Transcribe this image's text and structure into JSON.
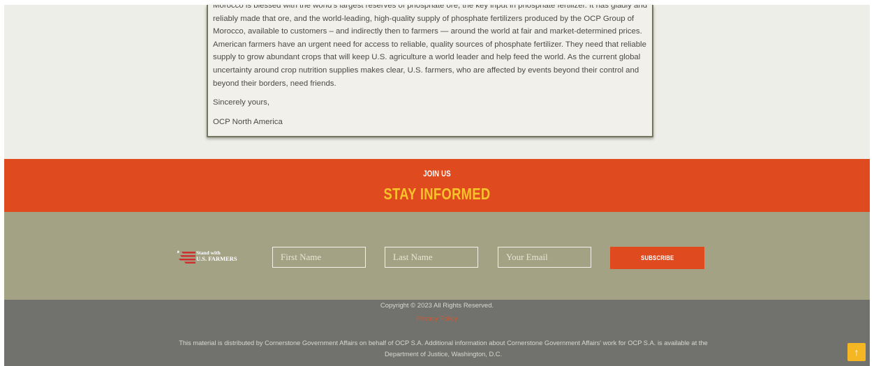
{
  "letter": {
    "paragraphs": [
      "Morocco is blessed with the world's largest reserves of phosphate ore, the key input in phosphate fertilizer. It has gladly and reliably made that ore, and the world-leading, high-quality supply of phosphate fertilizers produced by the OCP Group of Morocco, available to customers – and indirectly then to farmers — around the world at fair and market-determined prices. American farmers have an urgent need for access to reliable, quality sources of phosphate fertilizer. They need that reliable supply to grow abundant crops that will keep U.S. agriculture a world leader and help feed the world.  As the current global uncertainty around crop nutrition supplies makes clear, U.S. farmers, who are affected by events beyond their control and beyond their borders, need friends.",
      "Sincerely yours,",
      "OCP North America"
    ]
  },
  "join": {
    "kicker": "JOIN US",
    "title": "STAY INFORMED"
  },
  "subscribe": {
    "logo": {
      "line1": "Stand with",
      "line2": "U.S. FARMERS"
    },
    "first_name_placeholder": "First Name",
    "last_name_placeholder": "Last Name",
    "email_placeholder": "Your Email",
    "button_label": "SUBSCRIBE"
  },
  "footer": {
    "copyright": "Copyright © 2023  All Rights Reserved.",
    "privacy_link": "Privacy Policy",
    "disclaimer": "This material is distributed by Cornerstone Government Affairs on behalf of OCP S.A. Additional information about Cornerstone Government Affairs' work for OCP S.A. is available at the Department of Justice, Washington, D.C.",
    "back_to_top": "↑"
  },
  "colors": {
    "join_band": "#df4a1f",
    "join_title": "#f9c22b",
    "subscribe_band": "#a3a285",
    "footer_band": "#71716d",
    "back_to_top": "#f5b623"
  },
  "icons": [
    "us-flag-stripes-icon",
    "arrow-up-icon"
  ]
}
